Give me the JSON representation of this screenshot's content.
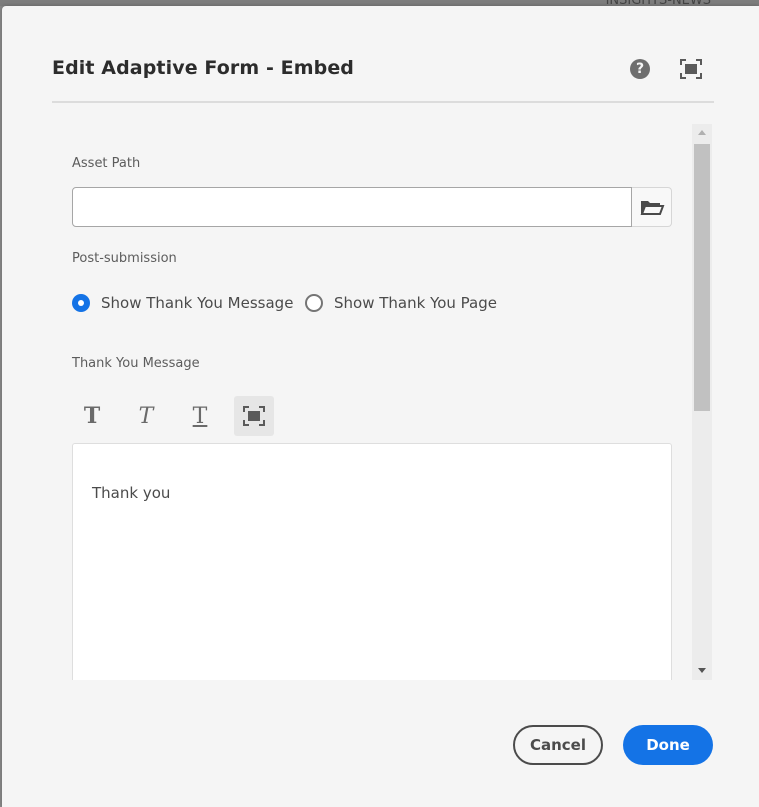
{
  "backdrop": {
    "partial_text": "INSIGHTS-NEWS"
  },
  "dialog": {
    "title": "Edit Adaptive Form - Embed",
    "help_icon": "help-circle-icon",
    "fullscreen_icon": "fullscreen-icon"
  },
  "form": {
    "asset_path": {
      "label": "Asset Path",
      "value": "",
      "placeholder": "",
      "browse_icon": "folder-open-icon"
    },
    "post_submission": {
      "label": "Post-submission",
      "options": [
        {
          "label": "Show Thank You Message",
          "checked": true
        },
        {
          "label": "Show Thank You Page",
          "checked": false
        }
      ]
    },
    "thank_you_message": {
      "label": "Thank You Message",
      "toolbar": [
        {
          "icon": "bold-icon",
          "glyph": "T"
        },
        {
          "icon": "italic-icon",
          "glyph": "T"
        },
        {
          "icon": "underline-icon",
          "glyph": "T"
        },
        {
          "icon": "fullscreen-icon"
        }
      ],
      "content": "Thank you"
    }
  },
  "footer": {
    "cancel_label": "Cancel",
    "done_label": "Done"
  },
  "colors": {
    "accent": "#1473e6",
    "dialog_bg": "#f5f5f5",
    "text": "#4b4b4b"
  }
}
